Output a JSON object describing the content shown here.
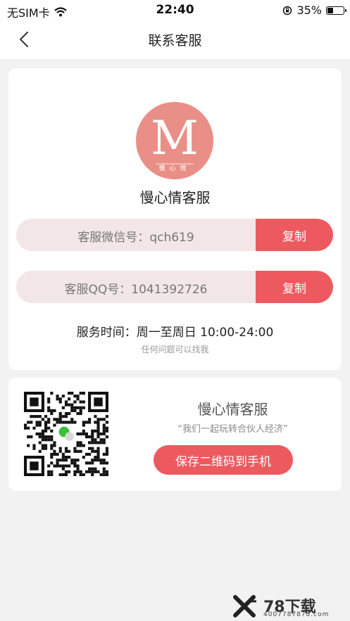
{
  "status_bar": {
    "carrier": "无SIM卡",
    "time": "22:40",
    "battery": "35%"
  },
  "nav": {
    "title": "联系客服"
  },
  "profile": {
    "logo_letter": "M",
    "logo_caption": "慢心情",
    "name": "慢心情客服"
  },
  "wechat": {
    "label": "客服微信号：",
    "value": "qch619",
    "copy_label": "复制"
  },
  "qq": {
    "label": "客服QQ号：",
    "value": "1041392726",
    "copy_label": "复制"
  },
  "service": {
    "time": "服务时间：周一至周日 10:00-24:00",
    "hint": "任何问题可以找我"
  },
  "qr_card": {
    "title": "慢心情客服",
    "slogan": "“我们一起玩转合伙人经济”",
    "save_label": "保存二维码到手机"
  },
  "watermark": {
    "brand": "78下载",
    "phone": "4007787878.com"
  },
  "colors": {
    "accent": "#ec5a5f",
    "pill_bg": "#f2e6e6",
    "logo_bg": "#e98f87"
  }
}
